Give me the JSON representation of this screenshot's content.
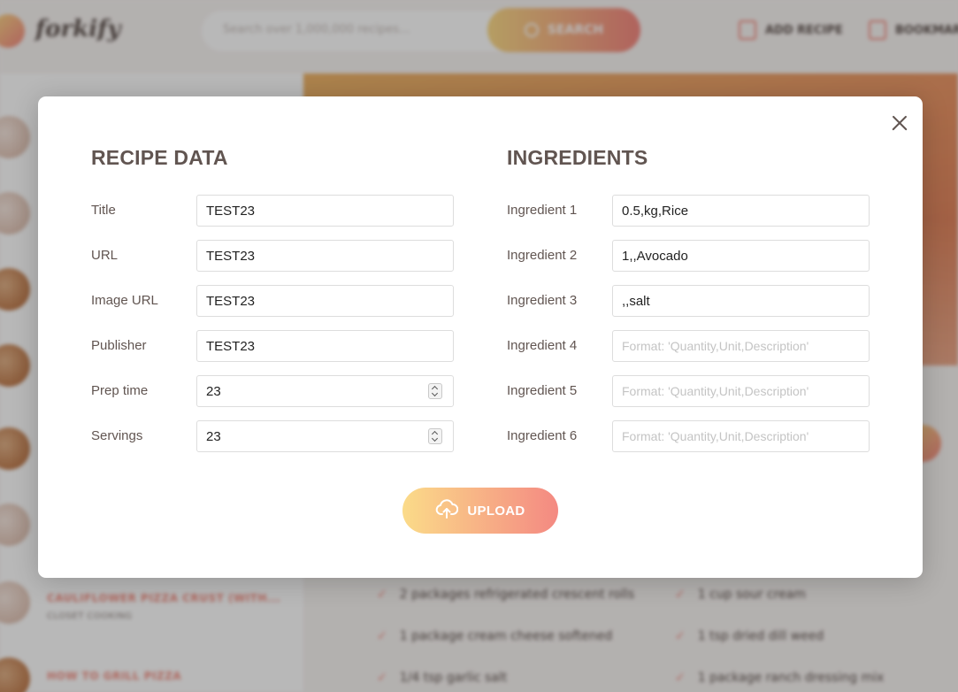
{
  "app": {
    "logo_text": "forkify",
    "search_placeholder": "Search over 1,000,000 recipes...",
    "search_button": "SEARCH",
    "nav": {
      "add_recipe": "ADD RECIPE",
      "bookmarks": "BOOKMARKS"
    }
  },
  "sidebar": {
    "results": [
      {
        "title": "CAULIFLOWER PIZZA CRUST (WITH...",
        "publisher": "CLOSET COOKING"
      },
      {
        "title": "HOW TO GRILL PIZZA",
        "publisher": ""
      }
    ]
  },
  "recipe_ingredients": [
    "2 packages refrigerated crescent rolls",
    "1 cup sour cream",
    "1 package cream cheese softened",
    "1 tsp dried dill weed",
    "1/4 tsp garlic salt",
    "1 package ranch dressing mix"
  ],
  "modal": {
    "close_icon": "close-icon",
    "recipe_heading": "RECIPE DATA",
    "ingredients_heading": "INGREDIENTS",
    "recipe_fields": [
      {
        "label": "Title",
        "value": "TEST23",
        "type": "text"
      },
      {
        "label": "URL",
        "value": "TEST23",
        "type": "text"
      },
      {
        "label": "Image URL",
        "value": "TEST23",
        "type": "text"
      },
      {
        "label": "Publisher",
        "value": "TEST23",
        "type": "text"
      },
      {
        "label": "Prep time",
        "value": "23",
        "type": "number"
      },
      {
        "label": "Servings",
        "value": "23",
        "type": "number"
      }
    ],
    "ingredient_fields": [
      {
        "label": "Ingredient 1",
        "value": "0.5,kg,Rice",
        "placeholder": ""
      },
      {
        "label": "Ingredient 2",
        "value": "1,,Avocado",
        "placeholder": ""
      },
      {
        "label": "Ingredient 3",
        "value": ",,salt",
        "placeholder": ""
      },
      {
        "label": "Ingredient 4",
        "value": "",
        "placeholder": "Format: 'Quantity,Unit,Description'"
      },
      {
        "label": "Ingredient 5",
        "value": "",
        "placeholder": "Format: 'Quantity,Unit,Description'"
      },
      {
        "label": "Ingredient 6",
        "value": "",
        "placeholder": "Format: 'Quantity,Unit,Description'"
      }
    ],
    "upload_button": "UPLOAD",
    "upload_icon": "cloud-upload-icon"
  },
  "colors": {
    "accent_start": "#fbdb89",
    "accent_end": "#f48982",
    "text": "#615551"
  }
}
